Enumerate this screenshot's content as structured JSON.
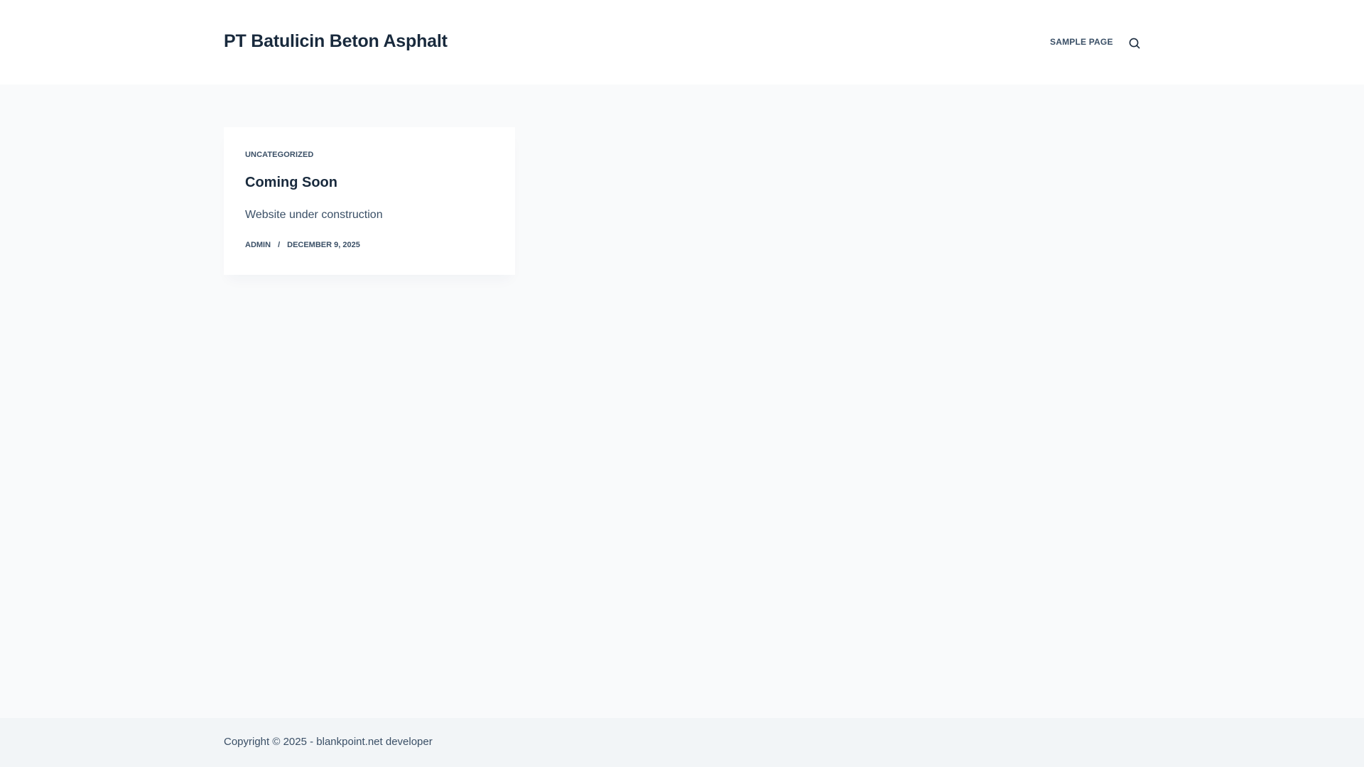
{
  "header": {
    "site_title": "PT Batulicin Beton Asphalt",
    "nav": {
      "sample_page": "SAMPLE PAGE"
    },
    "search_icon": "search-icon"
  },
  "post": {
    "category": "UNCATEGORIZED",
    "title": "Coming Soon",
    "excerpt": "Website under construction",
    "author": "ADMIN",
    "separator": "/",
    "date": "DECEMBER 9, 2025"
  },
  "footer": {
    "copyright": "Copyright © 2025 - blankpoint.net developer"
  },
  "colors": {
    "background": "#f9fafb",
    "header_background": "#ffffff",
    "footer_background": "#f2f5f7",
    "heading": "#192a3d",
    "text": "#3a4f66"
  }
}
